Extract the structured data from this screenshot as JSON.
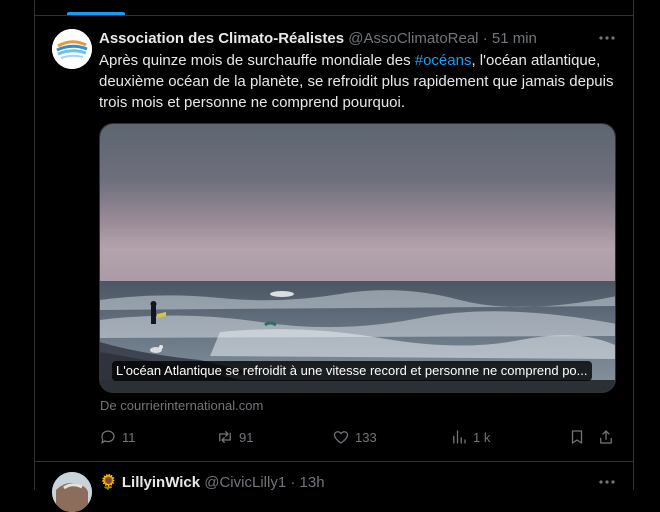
{
  "tweet1": {
    "author_name": "Association des Climato-Réalistes",
    "handle": "@AssoClimatoReal",
    "separator": "·",
    "time": "51 min",
    "text_before": "Après quinze mois de surchauffe mondiale des ",
    "hashtag": "#océans",
    "text_after": ", l'océan atlantique, deuxième océan de la planète, se refroidit plus rapidement que jamais depuis trois mois et personne ne comprend pourquoi.",
    "card": {
      "title": "L'océan Atlantique se refroidit à une vitesse record et personne ne comprend po...",
      "source": "De courrierinternational.com"
    },
    "actions": {
      "replies": "11",
      "reposts": "91",
      "likes": "133",
      "views": "1 k"
    }
  },
  "tweet2": {
    "emoji": "🌻",
    "author_name": "LillyinWick",
    "handle": "@CivicLilly1",
    "separator": "·",
    "time": "13h"
  },
  "colors": {
    "accent": "#1d9bf0",
    "text": "#e7e9ea",
    "muted": "#71767b",
    "border": "#2f3336",
    "background": "#000000"
  },
  "icons": [
    "reply-icon",
    "repost-icon",
    "like-icon",
    "views-icon",
    "bookmark-icon",
    "share-icon",
    "more-icon"
  ]
}
